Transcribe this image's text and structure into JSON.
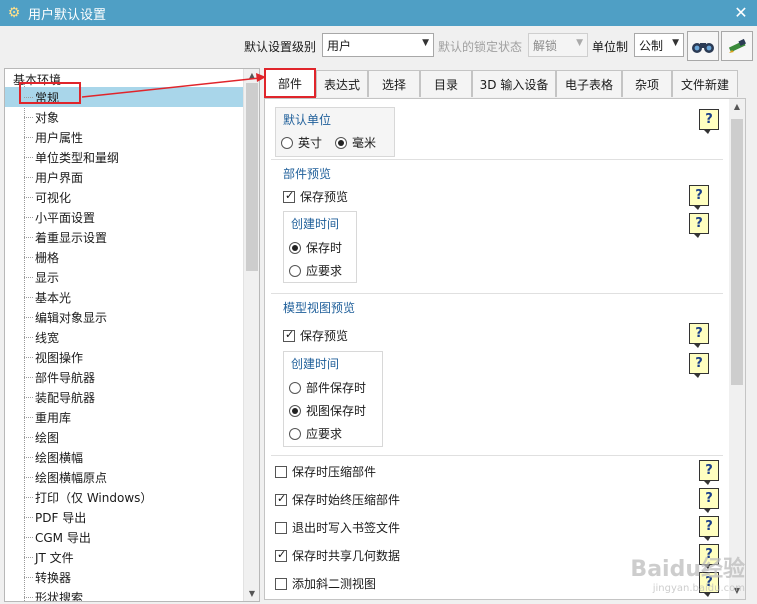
{
  "window": {
    "title": "用户默认设置",
    "close_glyph": "✕"
  },
  "toolbar": {
    "level_label": "默认设置级别",
    "level_value": "用户",
    "lock_label": "默认的锁定状态",
    "lock_value": "解锁",
    "unit_label": "单位制",
    "unit_value": "公制",
    "btn1_icon": "binoculars-icon",
    "btn2_icon": "magic-wand-icon"
  },
  "tree": {
    "root": "基本环境",
    "items": [
      "常规",
      "对象",
      "用户属性",
      "单位类型和量纲",
      "用户界面",
      "可视化",
      "小平面设置",
      "着重显示设置",
      "栅格",
      "显示",
      "基本光",
      "编辑对象显示",
      "线宽",
      "视图操作",
      "部件导航器",
      "装配导航器",
      "重用库",
      "绘图",
      "绘图横幅",
      "绘图横幅原点",
      "打印（仅 Windows）",
      "PDF 导出",
      "CGM 导出",
      "JT 文件",
      "转换器",
      "形状搜索"
    ]
  },
  "tabs": [
    "部件",
    "表达式",
    "选择",
    "目录",
    "3D 输入设备",
    "电子表格",
    "杂项",
    "文件新建"
  ],
  "content": {
    "default_unit_title": "默认单位",
    "unit_inch": "英寸",
    "unit_mm": "毫米",
    "part_preview_title": "部件预览",
    "save_preview": "保存预览",
    "create_time_title": "创建时间",
    "on_save": "保存时",
    "on_demand": "应要求",
    "model_view_title": "模型视图预览",
    "save_preview2": "保存预览",
    "create_time_title2": "创建时间",
    "on_part_save": "部件保存时",
    "on_view_save": "视图保存时",
    "on_demand2": "应要求",
    "options": [
      "保存时压缩部件",
      "保存时始终压缩部件",
      "退出时写入书签文件",
      "保存时共享几何数据",
      "添加斜二测视图"
    ],
    "options_checked": [
      false,
      true,
      false,
      true,
      false
    ],
    "help_glyph": "?"
  },
  "watermark": {
    "main": "Baidu经验",
    "sub": "jingyan.baidu.com"
  },
  "colors": {
    "titlebar": "#4f9fc5",
    "selection": "#a9d6ea",
    "annotation": "#e0252b",
    "group_title": "#1f5f9a"
  }
}
